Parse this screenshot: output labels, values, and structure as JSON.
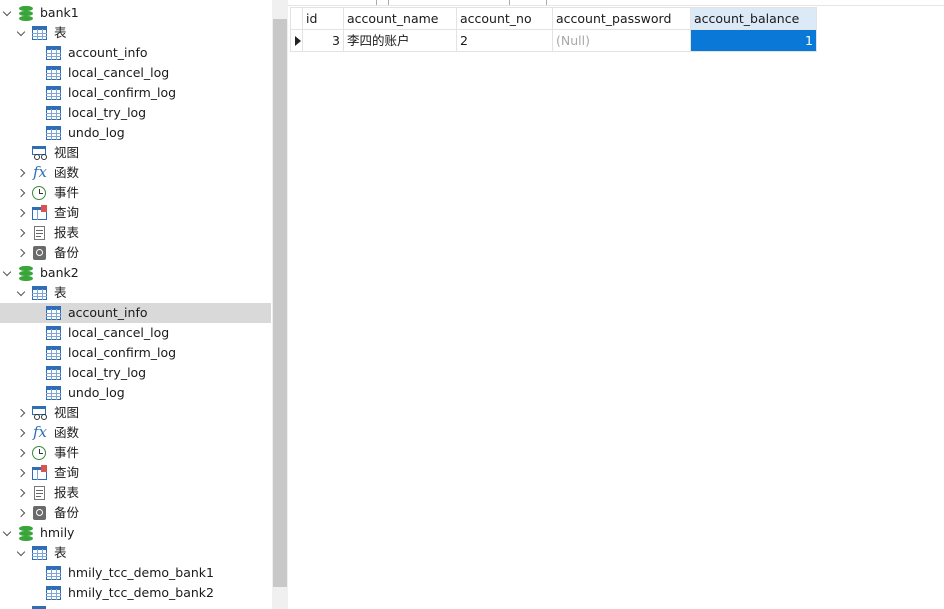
{
  "tree": {
    "databases": [
      {
        "name": "bank1",
        "expanded": true,
        "tables_label": "表",
        "tables": [
          "account_info",
          "local_cancel_log",
          "local_confirm_log",
          "local_try_log",
          "undo_log"
        ],
        "views_label": "视图",
        "functions_label": "函数",
        "events_label": "事件",
        "queries_label": "查询",
        "reports_label": "报表",
        "backups_label": "备份"
      },
      {
        "name": "bank2",
        "expanded": true,
        "tables_label": "表",
        "tables": [
          "account_info",
          "local_cancel_log",
          "local_confirm_log",
          "local_try_log",
          "undo_log"
        ],
        "selected_table": "account_info",
        "views_label": "视图",
        "functions_label": "函数",
        "events_label": "事件",
        "queries_label": "查询",
        "reports_label": "报表",
        "backups_label": "备份"
      },
      {
        "name": "hmily",
        "expanded": true,
        "tables_label": "表",
        "tables": [
          "hmily_tcc_demo_bank1",
          "hmily_tcc_demo_bank2"
        ]
      }
    ],
    "fx_glyph": "fx",
    "colors": {
      "db_icon": "#3aa53a",
      "table_icon": "#2f6db5",
      "selected_row": "#d9d9d9"
    }
  },
  "grid": {
    "columns": [
      "id",
      "account_name",
      "account_no",
      "account_password",
      "account_balance"
    ],
    "selected_column": "account_balance",
    "rows": [
      {
        "id": "3",
        "account_name": "李四的账户",
        "account_no": "2",
        "account_password": "(Null)",
        "account_balance": "1"
      }
    ],
    "colors": {
      "current_cell": "#0a78d7",
      "selected_header": "#dceaf8",
      "null_text": "#a8a8a8"
    }
  }
}
